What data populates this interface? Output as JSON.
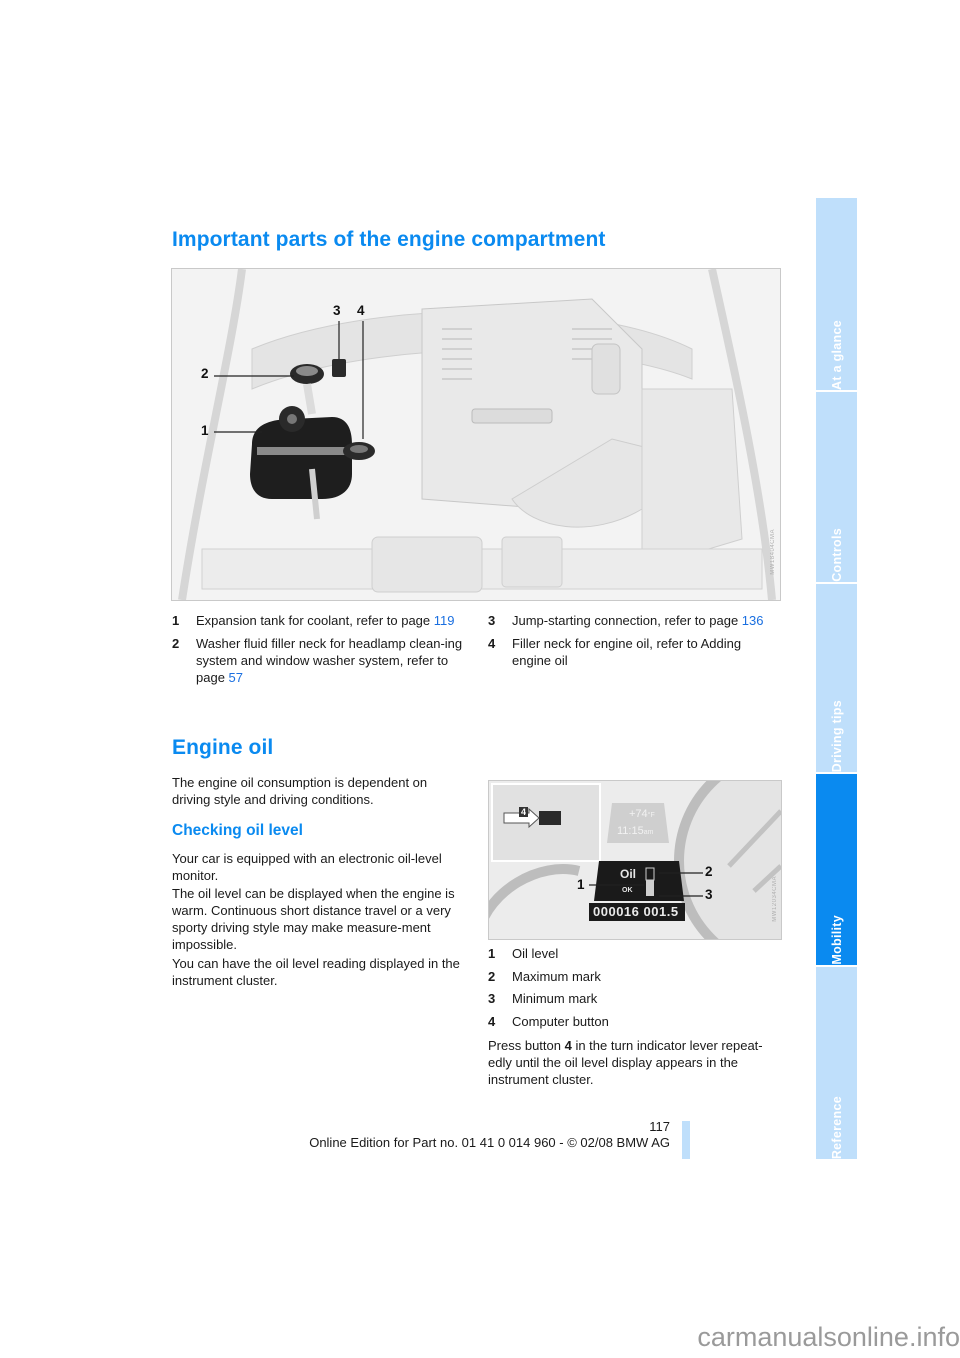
{
  "sections": {
    "engine_compartment": {
      "title": "Important parts of the engine compartment",
      "figure": {
        "callouts": [
          "1",
          "2",
          "3",
          "4"
        ],
        "code": "MW18404CMA"
      },
      "items": [
        {
          "num": "1",
          "text": "Expansion tank for coolant, refer to page ",
          "link": "119"
        },
        {
          "num": "2",
          "text": "Washer fluid filler neck for headlamp clean-ing system and window washer system, refer to page ",
          "link": "57"
        },
        {
          "num": "3",
          "text": "Jump-starting connection, refer to page ",
          "link": "136"
        },
        {
          "num": "4",
          "text": "Filler neck for engine oil, refer to Adding engine oil",
          "link": ""
        }
      ]
    },
    "engine_oil": {
      "title": "Engine oil",
      "intro": "The engine oil consumption is dependent on driving style and driving conditions.",
      "subsection": {
        "title": "Checking oil level",
        "paragraphs": [
          "Your car is equipped with an electronic oil-level monitor.",
          "The oil level can be displayed when the engine is warm. Continuous short distance travel or a very sporty driving style may make measure-ment impossible.",
          "You can have the oil level reading displayed in the instrument cluster."
        ]
      },
      "figure": {
        "temperature": "+74",
        "temp_unit": "°F",
        "time": "11:15",
        "time_suffix": "am",
        "oil_label": "Oil",
        "ok_label": "OK",
        "odometer": "000016",
        "trip": "001.5",
        "lever_button": "4",
        "callouts": [
          "1",
          "2",
          "3"
        ],
        "code": "MW12034CMA"
      },
      "legend": [
        {
          "num": "1",
          "text": "Oil level"
        },
        {
          "num": "2",
          "text": "Maximum mark"
        },
        {
          "num": "3",
          "text": "Minimum mark"
        },
        {
          "num": "4",
          "text": "Computer button"
        }
      ],
      "instruction_pre": "Press button ",
      "instruction_bold": "4",
      "instruction_post": " in the turn indicator lever repeat-edly until the oil level display appears in the instrument cluster."
    }
  },
  "sidebar": {
    "tabs": [
      {
        "label": "At a glance",
        "active": false
      },
      {
        "label": "Controls",
        "active": false
      },
      {
        "label": "Driving tips",
        "active": false
      },
      {
        "label": "Mobility",
        "active": true
      },
      {
        "label": "Reference",
        "active": false
      }
    ]
  },
  "footer": {
    "page_number": "117",
    "edition": "Online Edition for Part no. 01 41 0 014 960 - © 02/08 BMW AG"
  },
  "watermark": "carmanualsonline.info",
  "colors": {
    "heading": "#0a8af0",
    "link": "#1a6fe0",
    "tab_inactive": "#bfdffb",
    "tab_active": "#0a8af0"
  }
}
